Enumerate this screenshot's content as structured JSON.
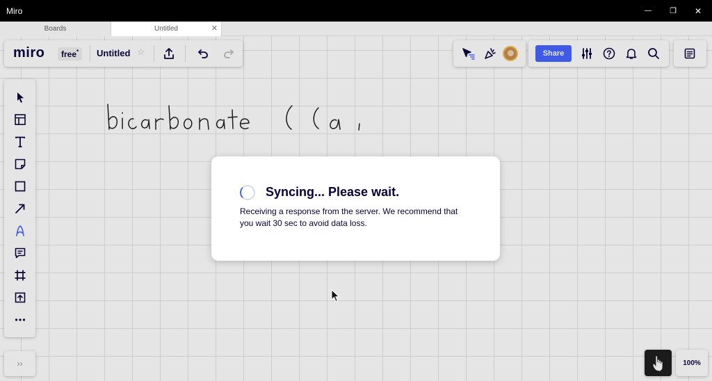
{
  "window": {
    "title": "Miro",
    "minimize_glyph": "—",
    "maximize_glyph": "❐",
    "close_glyph": "✕"
  },
  "tabs": [
    {
      "label": "Boards",
      "active": false
    },
    {
      "label": "Untitled",
      "active": true,
      "close_glyph": "✕"
    }
  ],
  "header": {
    "logo": "miro",
    "plan": "free",
    "plan_marker": "*",
    "board_title": "Untitled",
    "star_glyph": "☆"
  },
  "share": {
    "label": "Share"
  },
  "canvas": {
    "handwriting": "bicarbonate ( Ca,"
  },
  "dialog": {
    "title": "Syncing... Please wait.",
    "message": "Receiving a response from the server. We recommend that you wait 30 sec to avoid data loss."
  },
  "bottom": {
    "collapse_glyph": "››",
    "zoom": "100%"
  },
  "colors": {
    "brand_blue": "#4262ff",
    "text_dark": "#050038",
    "titlebar": "#000000"
  },
  "icons": {
    "toolbar": [
      "select-icon",
      "templates-icon",
      "text-icon",
      "sticky-note-icon",
      "shape-icon",
      "arrow-icon",
      "pen-icon",
      "comment-icon",
      "frame-icon",
      "upload-icon",
      "more-icon"
    ],
    "header": [
      "export-icon",
      "undo-icon",
      "redo-icon"
    ],
    "collab": [
      "cursor-filter-icon",
      "celebrate-icon",
      "avatar"
    ],
    "right": [
      "settings-icon",
      "help-icon",
      "bell-icon",
      "search-icon",
      "notes-icon",
      "hand-icon"
    ]
  }
}
